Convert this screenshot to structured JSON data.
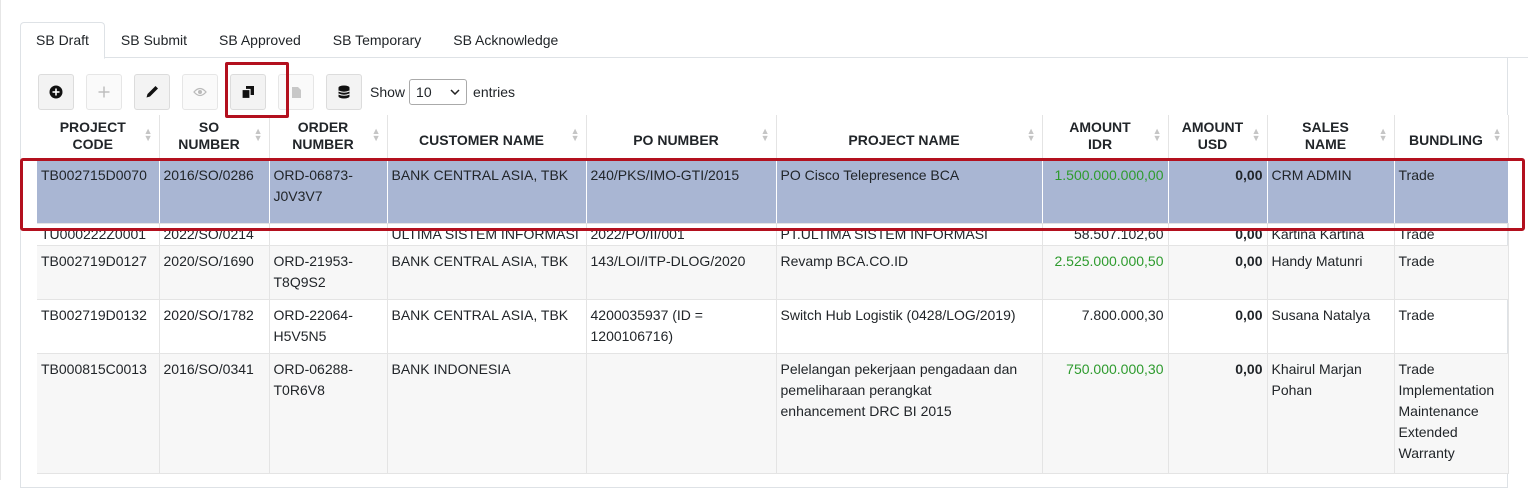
{
  "tabs": [
    "SB Draft",
    "SB Submit",
    "SB Approved",
    "SB Temporary",
    "SB Acknowledge"
  ],
  "toolbar": {
    "buttons": [
      "add-circle-icon",
      "plus-icon",
      "pencil-icon",
      "eye-icon",
      "copy-icon",
      "file-icon",
      "database-icon"
    ],
    "show_label": "Show",
    "entries_value": "10",
    "entries_label": "entries"
  },
  "columns": [
    {
      "label_1": "PROJECT",
      "label_2": "CODE"
    },
    {
      "label_1": "SO",
      "label_2": "NUMBER"
    },
    {
      "label_1": "ORDER",
      "label_2": "NUMBER"
    },
    {
      "label_1": "CUSTOMER NAME"
    },
    {
      "label_1": "PO NUMBER"
    },
    {
      "label_1": "PROJECT NAME"
    },
    {
      "label_1": "AMOUNT",
      "label_2": "IDR"
    },
    {
      "label_1": "AMOUNT",
      "label_2": "USD"
    },
    {
      "label_1": "SALES",
      "label_2": "NAME"
    },
    {
      "label_1": "BUNDLING"
    }
  ],
  "rows": [
    {
      "project_code": "TB002715D0070",
      "so_number": "2016/SO/0286",
      "order_1": "ORD-06873-",
      "order_2": "J0V3V7",
      "customer": "BANK CENTRAL ASIA, TBK",
      "po_1": "240/PKS/IMO-GTI/2015",
      "po_2": "",
      "project_1": "PO Cisco Telepresence BCA",
      "project_2": "",
      "project_3": "",
      "amount_idr": "1.500.000.000,00",
      "amount_usd": "0,00",
      "sales_1": "CRM ADMIN",
      "sales_2": "",
      "bundling": [
        "Trade"
      ]
    },
    {
      "project_code": "TU000222Z0001",
      "so_number": "2022/SO/0214",
      "order_1": "",
      "order_2": "",
      "customer": "ULTIMA SISTEM INFORMASI",
      "po_1": "2022/PO/II/001",
      "po_2": "",
      "project_1": "PT.ULTIMA SISTEM INFORMASI",
      "project_2": "",
      "project_3": "",
      "amount_idr": "58.507.102,60",
      "amount_usd": "0,00",
      "sales_1": "Kartina Kartina",
      "sales_2": "",
      "bundling": [
        "Trade"
      ]
    },
    {
      "project_code": "TB002719D0127",
      "so_number": "2020/SO/1690",
      "order_1": "ORD-21953-",
      "order_2": "T8Q9S2",
      "customer": "BANK CENTRAL ASIA, TBK",
      "po_1": "143/LOI/ITP-DLOG/2020",
      "po_2": "",
      "project_1": "Revamp BCA.CO.ID",
      "project_2": "",
      "project_3": "",
      "amount_idr": "2.525.000.000,50",
      "amount_usd": "0,00",
      "sales_1": "Handy Matunri",
      "sales_2": "",
      "bundling": [
        "Trade"
      ]
    },
    {
      "project_code": "TB002719D0132",
      "so_number": "2020/SO/1782",
      "order_1": "ORD-22064-",
      "order_2": "H5V5N5",
      "customer": "BANK CENTRAL ASIA, TBK",
      "po_1": "4200035937 (ID =",
      "po_2": "1200106716)",
      "project_1": "Switch Hub Logistik (0428/LOG/2019)",
      "project_2": "",
      "project_3": "",
      "amount_idr": "7.800.000,30",
      "amount_usd": "0,00",
      "sales_1": "Susana Natalya",
      "sales_2": "",
      "bundling": [
        "Trade"
      ]
    },
    {
      "project_code": "TB000815C0013",
      "so_number": "2016/SO/0341",
      "order_1": "ORD-06288-",
      "order_2": "T0R6V8",
      "customer": "BANK INDONESIA",
      "po_1": "",
      "po_2": "",
      "project_1": "Pelelangan pekerjaan pengadaan dan",
      "project_2": "pemeliharaan perangkat",
      "project_3": "enhancement DRC BI 2015",
      "amount_idr": "750.000.000,30",
      "amount_usd": "0,00",
      "sales_1": "Khairul Marjan",
      "sales_2": "Pohan",
      "bundling": [
        "Trade",
        "Implementation",
        "Maintenance",
        "Extended",
        "Warranty"
      ]
    }
  ],
  "colors": {
    "selected_row": "#a9b6d3",
    "highlight_border": "#b3101e",
    "amount_green": "#2e9b2e"
  }
}
